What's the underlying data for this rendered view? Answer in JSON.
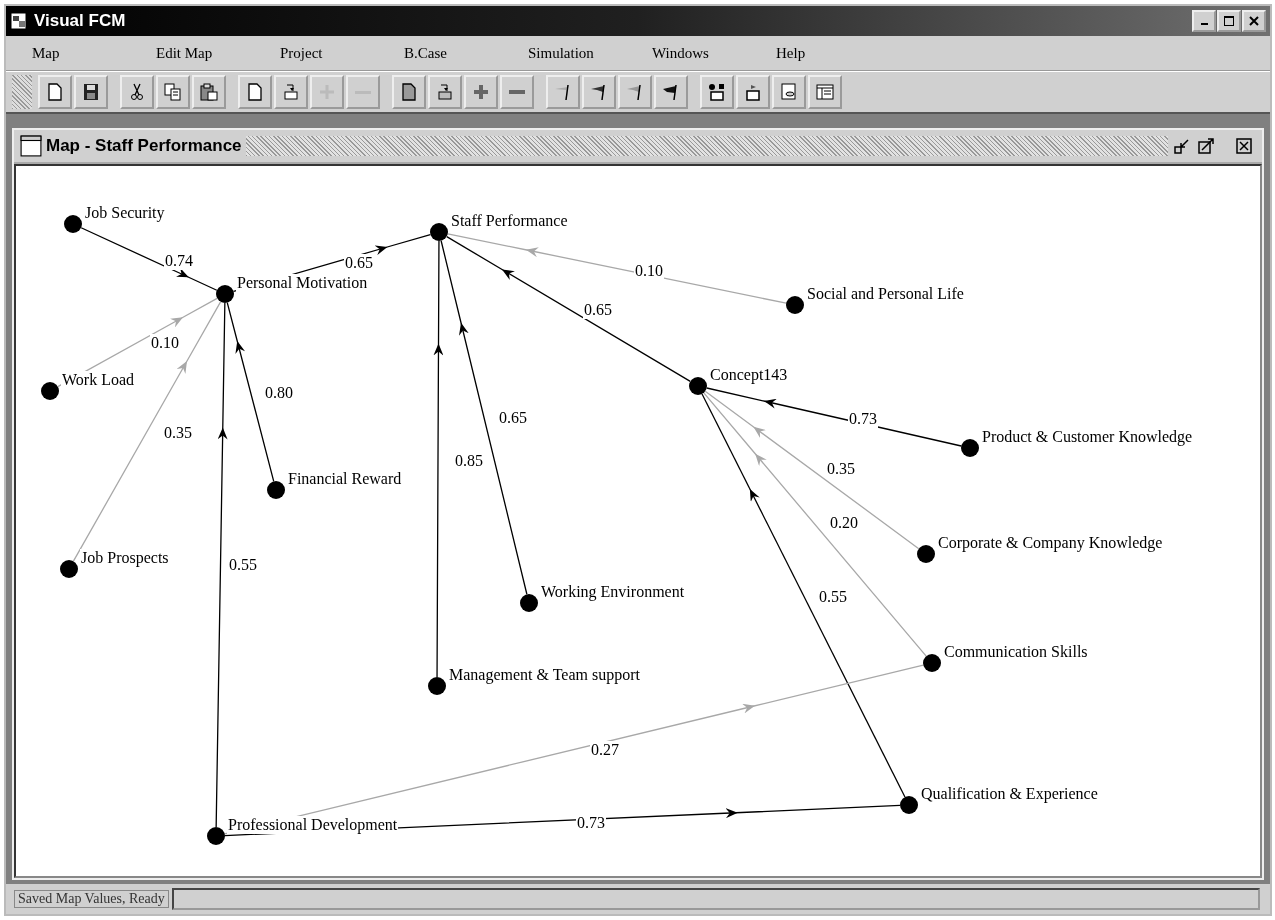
{
  "window": {
    "title": "Visual FCM"
  },
  "menu": [
    "Map",
    "Edit Map",
    "Project",
    "B.Case",
    "Simulation",
    "Windows",
    "Help"
  ],
  "toolbar": [
    {
      "buttons": [
        {
          "disabled": false
        },
        {
          "disabled": false
        }
      ]
    },
    {
      "buttons": [
        {
          "disabled": false
        },
        {
          "disabled": false
        },
        {
          "disabled": false
        }
      ]
    },
    {
      "buttons": [
        {
          "disabled": false
        },
        {
          "disabled": false
        },
        {
          "disabled": true
        },
        {
          "disabled": true
        }
      ]
    },
    {
      "buttons": [
        {
          "disabled": false
        },
        {
          "disabled": false
        },
        {
          "disabled": false
        },
        {
          "disabled": false
        }
      ]
    },
    {
      "buttons": [
        {
          "disabled": false
        },
        {
          "disabled": false
        },
        {
          "disabled": false
        },
        {
          "disabled": false
        }
      ]
    },
    {
      "buttons": [
        {
          "disabled": false
        },
        {
          "disabled": false
        },
        {
          "disabled": false
        },
        {
          "disabled": false
        }
      ]
    }
  ],
  "map_window": {
    "title": "Map - Staff Performance"
  },
  "nodes": [
    {
      "label": "Job Security"
    },
    {
      "label": "Personal Motivation"
    },
    {
      "label": "Staff Performance"
    },
    {
      "label": "Work Load"
    },
    {
      "label": "Financial Reward"
    },
    {
      "label": "Job Prospects"
    },
    {
      "label": "Social and Personal Life"
    },
    {
      "label": "Concept143"
    },
    {
      "label": "Product & Customer Knowledge"
    },
    {
      "label": "Corporate & Company Knowledge"
    },
    {
      "label": "Working Environment"
    },
    {
      "label": "Communication Skills"
    },
    {
      "label": "Management & Team support"
    },
    {
      "label": "Qualification & Experience"
    },
    {
      "label": "Professional Development"
    }
  ],
  "edges": [
    {
      "weight": "0.74",
      "color": "#000000"
    },
    {
      "weight": "0.65",
      "color": "#000000"
    },
    {
      "weight": "0.10",
      "color": "#a8a8a8"
    },
    {
      "weight": "0.35",
      "color": "#a8a8a8"
    },
    {
      "weight": "0.80",
      "color": "#000000"
    },
    {
      "weight": "0.55",
      "color": "#000000"
    },
    {
      "weight": "0.85",
      "color": "#000000"
    },
    {
      "weight": "0.65",
      "color": "#000000"
    },
    {
      "weight": "0.10",
      "color": "#a8a8a8"
    },
    {
      "weight": "0.65",
      "color": "#000000"
    },
    {
      "weight": "0.73",
      "color": "#000000"
    },
    {
      "weight": "0.35",
      "color": "#a8a8a8"
    },
    {
      "weight": "0.20",
      "color": "#a8a8a8"
    },
    {
      "weight": "0.55",
      "color": "#000000"
    },
    {
      "weight": "0.27",
      "color": "#a8a8a8"
    },
    {
      "weight": "0.73",
      "color": "#000000"
    }
  ],
  "status_bar": {
    "text": "Saved Map Values, Ready"
  }
}
